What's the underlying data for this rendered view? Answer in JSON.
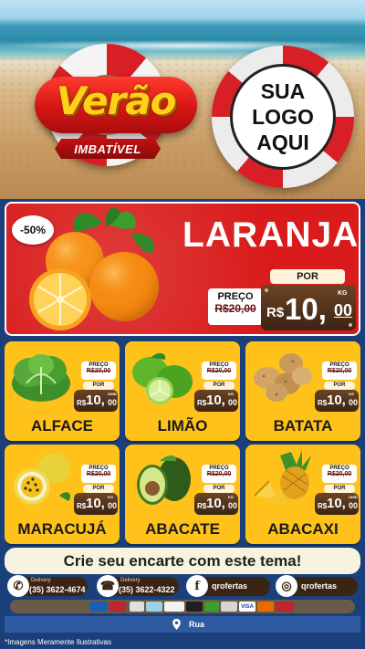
{
  "header": {
    "brand_title": "Verão",
    "brand_subtitle": "IMBATÍVEL",
    "logo_lines": [
      "SUA",
      "LOGO",
      "AQUI"
    ]
  },
  "hero": {
    "discount": "-50%",
    "product": "LARANJA",
    "por_label": "POR",
    "preco_label": "PREÇO",
    "old_price": "R$20,00",
    "currency": "R$",
    "price_int": "10,",
    "price_cents": "00",
    "unit": "KG"
  },
  "products": [
    {
      "name": "ALFACE",
      "preco_label": "PREÇO",
      "old_price": "R$20,00",
      "por_label": "POR",
      "currency": "R$",
      "price_int": "10,",
      "price_cents": "00",
      "unit": "UNID"
    },
    {
      "name": "LIMÃO",
      "preco_label": "PREÇO",
      "old_price": "R$20,00",
      "por_label": "POR",
      "currency": "R$",
      "price_int": "10,",
      "price_cents": "00",
      "unit": "KG"
    },
    {
      "name": "BATATA",
      "preco_label": "PREÇO",
      "old_price": "R$20,00",
      "por_label": "POR",
      "currency": "R$",
      "price_int": "10,",
      "price_cents": "00",
      "unit": "KG"
    },
    {
      "name": "MARACUJÁ",
      "preco_label": "PREÇO",
      "old_price": "R$20,00",
      "por_label": "POR",
      "currency": "R$",
      "price_int": "10,",
      "price_cents": "00",
      "unit": "KG"
    },
    {
      "name": "ABACATE",
      "preco_label": "PREÇO",
      "old_price": "R$20,00",
      "por_label": "POR",
      "currency": "R$",
      "price_int": "10,",
      "price_cents": "00",
      "unit": "KG"
    },
    {
      "name": "ABACAXI",
      "preco_label": "PREÇO",
      "old_price": "R$20,00",
      "por_label": "POR",
      "currency": "R$",
      "price_int": "10,",
      "price_cents": "00",
      "unit": "UNID"
    }
  ],
  "footer": {
    "cta": "Crie seu encarte com este tema!",
    "contacts": [
      {
        "icon": "whatsapp-icon",
        "label": "Delivery",
        "value": "(35) 3622-4674"
      },
      {
        "icon": "phone-icon",
        "label": "Delivery",
        "value": "(35) 3622-4322"
      },
      {
        "icon": "facebook-icon",
        "label": "",
        "value": "qrofertas"
      },
      {
        "icon": "instagram-icon",
        "label": "",
        "value": "qrofertas"
      }
    ],
    "payments": [
      "card",
      "card",
      "card",
      "card",
      "card",
      "card",
      "card",
      "card",
      "VISA",
      "card",
      "card"
    ],
    "address": "Rua",
    "disclaimer": "*Imagens Meramente Ilustrativas"
  },
  "colors": {
    "red": "#d91b1b",
    "yellow": "#ffc21a",
    "blue": "#1a3f7a",
    "brown": "#3c2413"
  }
}
